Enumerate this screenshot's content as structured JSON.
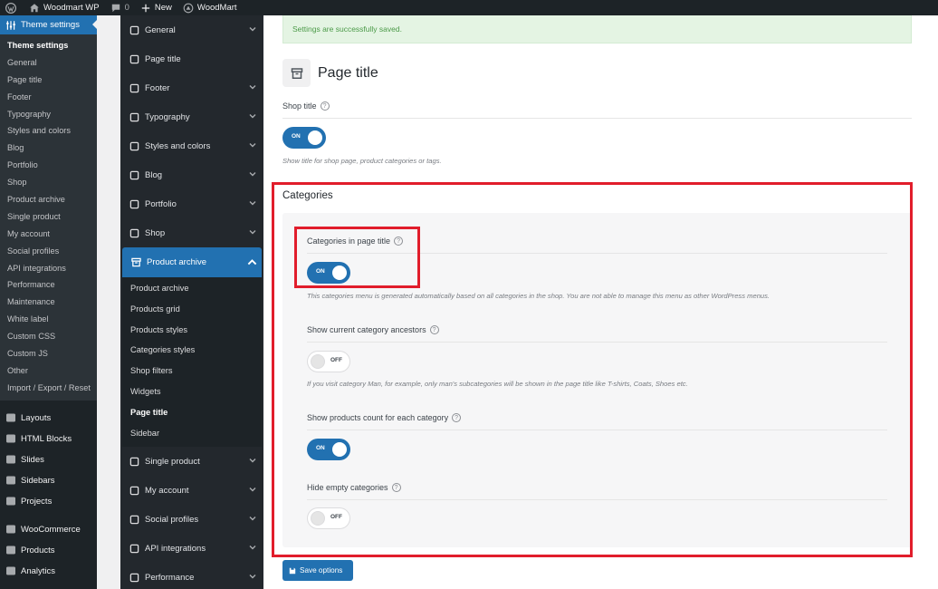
{
  "admin_bar": {
    "site_name": "Woodmart WP",
    "comments_count": "0",
    "new_label": "New",
    "theme_name": "WoodMart"
  },
  "wp_sidebar": {
    "active_label": "Theme settings",
    "submenu": [
      "Theme settings",
      "General",
      "Page title",
      "Footer",
      "Typography",
      "Styles and colors",
      "Blog",
      "Portfolio",
      "Shop",
      "Product archive",
      "Single product",
      "My account",
      "Social profiles",
      "API integrations",
      "Performance",
      "Maintenance",
      "White label",
      "Custom CSS",
      "Custom JS",
      "Other",
      "Import / Export / Reset"
    ],
    "menu_group1": [
      "Layouts",
      "HTML Blocks",
      "Slides",
      "Sidebars",
      "Projects"
    ],
    "menu_group2": [
      "WooCommerce",
      "Products",
      "Analytics"
    ]
  },
  "theme_nav": {
    "items_before": [
      "General",
      "Page title",
      "Footer",
      "Typography",
      "Styles and colors",
      "Blog",
      "Portfolio",
      "Shop"
    ],
    "active": "Product archive",
    "subitems": [
      "Product archive",
      "Products grid",
      "Products styles",
      "Categories styles",
      "Shop filters",
      "Widgets",
      "Page title",
      "Sidebar"
    ],
    "items_after": [
      "Single product",
      "My account",
      "Social profiles",
      "API integrations",
      "Performance"
    ]
  },
  "content": {
    "notice": "Settings are successfully saved.",
    "page_title": "Page title",
    "shop_title_label": "Shop title",
    "shop_title_toggle": "ON",
    "shop_title_desc": "Show title for shop page, product categories or tags.",
    "categories_heading": "Categories",
    "fields": [
      {
        "label": "Categories in page title",
        "toggle": "ON",
        "desc": "This categories menu is generated automatically based on all categories in the shop. You are not able to manage this menu as other WordPress menus."
      },
      {
        "label": "Show current category ancestors",
        "toggle": "OFF",
        "desc": "If you visit category Man, for example, only man's subcategories will be shown in the page title like T-shirts, Coats, Shoes etc."
      },
      {
        "label": "Show products count for each category",
        "toggle": "ON",
        "desc": ""
      },
      {
        "label": "Hide empty categories",
        "toggle": "OFF",
        "desc": ""
      }
    ],
    "save_label": "Save options",
    "help_glyph": "?"
  },
  "colors": {
    "accent": "#2271b1",
    "highlight_box": "#e11d2b",
    "notice_bg": "#e4f4e3"
  }
}
